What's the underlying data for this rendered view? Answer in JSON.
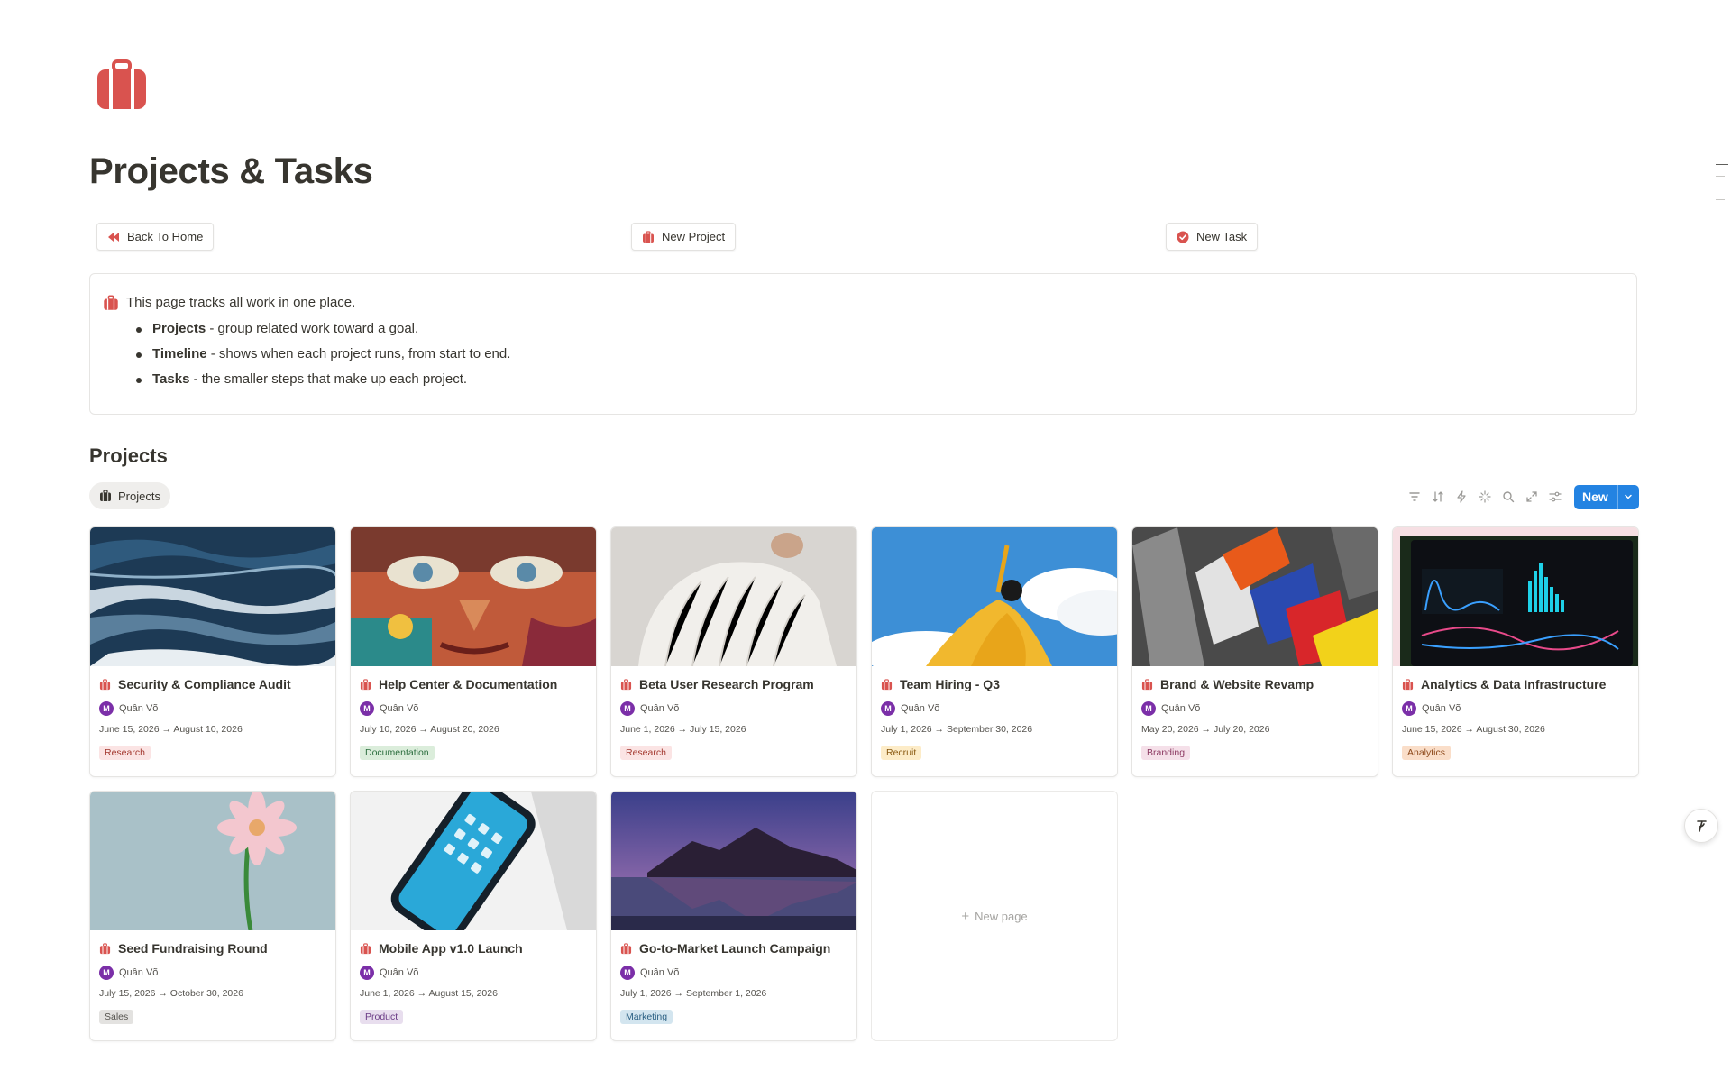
{
  "page": {
    "title": "Projects & Tasks",
    "icon": "briefcase-icon",
    "accent_color": "#d9534f"
  },
  "actions": [
    {
      "label": "Back To Home",
      "icon": "rewind-icon"
    },
    {
      "label": "New Project",
      "icon": "briefcase-icon"
    },
    {
      "label": "New Task",
      "icon": "check-circle-icon"
    }
  ],
  "callout": {
    "intro": "This page tracks all work in one place.",
    "items": [
      {
        "term": "Projects",
        "desc": " - group related work toward a goal."
      },
      {
        "term": "Timeline",
        "desc": " - shows when each project runs, from start to end."
      },
      {
        "term": "Tasks",
        "desc": " - the smaller steps that make up each project."
      }
    ]
  },
  "section": {
    "title": "Projects",
    "view_tab": "Projects",
    "new_button": "New"
  },
  "cards": [
    {
      "title": "Security & Compliance Audit",
      "owner": "Quân Võ",
      "avatar": "M",
      "dates": "June 15, 2026 → August 10, 2026",
      "tag": "Research",
      "tag_bg": "#fbe4e4",
      "tag_fg": "#a3382f",
      "cover": "ocean"
    },
    {
      "title": "Help Center & Documentation",
      "owner": "Quân Võ",
      "avatar": "M",
      "dates": "July 10, 2026 → August 20, 2026",
      "tag": "Documentation",
      "tag_bg": "#dbeddb",
      "tag_fg": "#2c6e3f",
      "cover": "mural"
    },
    {
      "title": "Beta User Research Program",
      "owner": "Quân Võ",
      "avatar": "M",
      "dates": "June 1, 2026 → July 15, 2026",
      "tag": "Research",
      "tag_bg": "#fbe4e4",
      "tag_fg": "#a3382f",
      "cover": "sweater"
    },
    {
      "title": "Team Hiring - Q3",
      "owner": "Quân Võ",
      "avatar": "M",
      "dates": "July 1, 2026 → September 30, 2026",
      "tag": "Recruit",
      "tag_bg": "#fdecc8",
      "tag_fg": "#8a5a12",
      "cover": "sky"
    },
    {
      "title": "Brand & Website Revamp",
      "owner": "Quân Võ",
      "avatar": "M",
      "dates": "May 20, 2026 → July 20, 2026",
      "tag": "Branding",
      "tag_bg": "#f5e0e9",
      "tag_fg": "#8d3b63",
      "cover": "paint"
    },
    {
      "title": "Analytics & Data Infrastructure",
      "owner": "Quân Võ",
      "avatar": "M",
      "dates": "June 15, 2026 → August 30, 2026",
      "tag": "Analytics",
      "tag_bg": "#fadec9",
      "tag_fg": "#8e4a1c",
      "cover": "dashboard"
    },
    {
      "title": "Seed Fundraising Round",
      "owner": "Quân Võ",
      "avatar": "M",
      "dates": "July 15, 2026 → October 30, 2026",
      "tag": "Sales",
      "tag_bg": "#e3e2e0",
      "tag_fg": "#55534e",
      "cover": "flower"
    },
    {
      "title": "Mobile App v1.0 Launch",
      "owner": "Quân Võ",
      "avatar": "M",
      "dates": "June 1, 2026 → August 15, 2026",
      "tag": "Product",
      "tag_bg": "#e8deee",
      "tag_fg": "#6b3c86",
      "cover": "phone"
    },
    {
      "title": "Go-to-Market Launch Campaign",
      "owner": "Quân Võ",
      "avatar": "M",
      "dates": "July 1, 2026 → September 1, 2026",
      "tag": "Marketing",
      "tag_bg": "#d3e5ef",
      "tag_fg": "#2a5f82",
      "cover": "mountain"
    }
  ],
  "new_page_label": "New page"
}
